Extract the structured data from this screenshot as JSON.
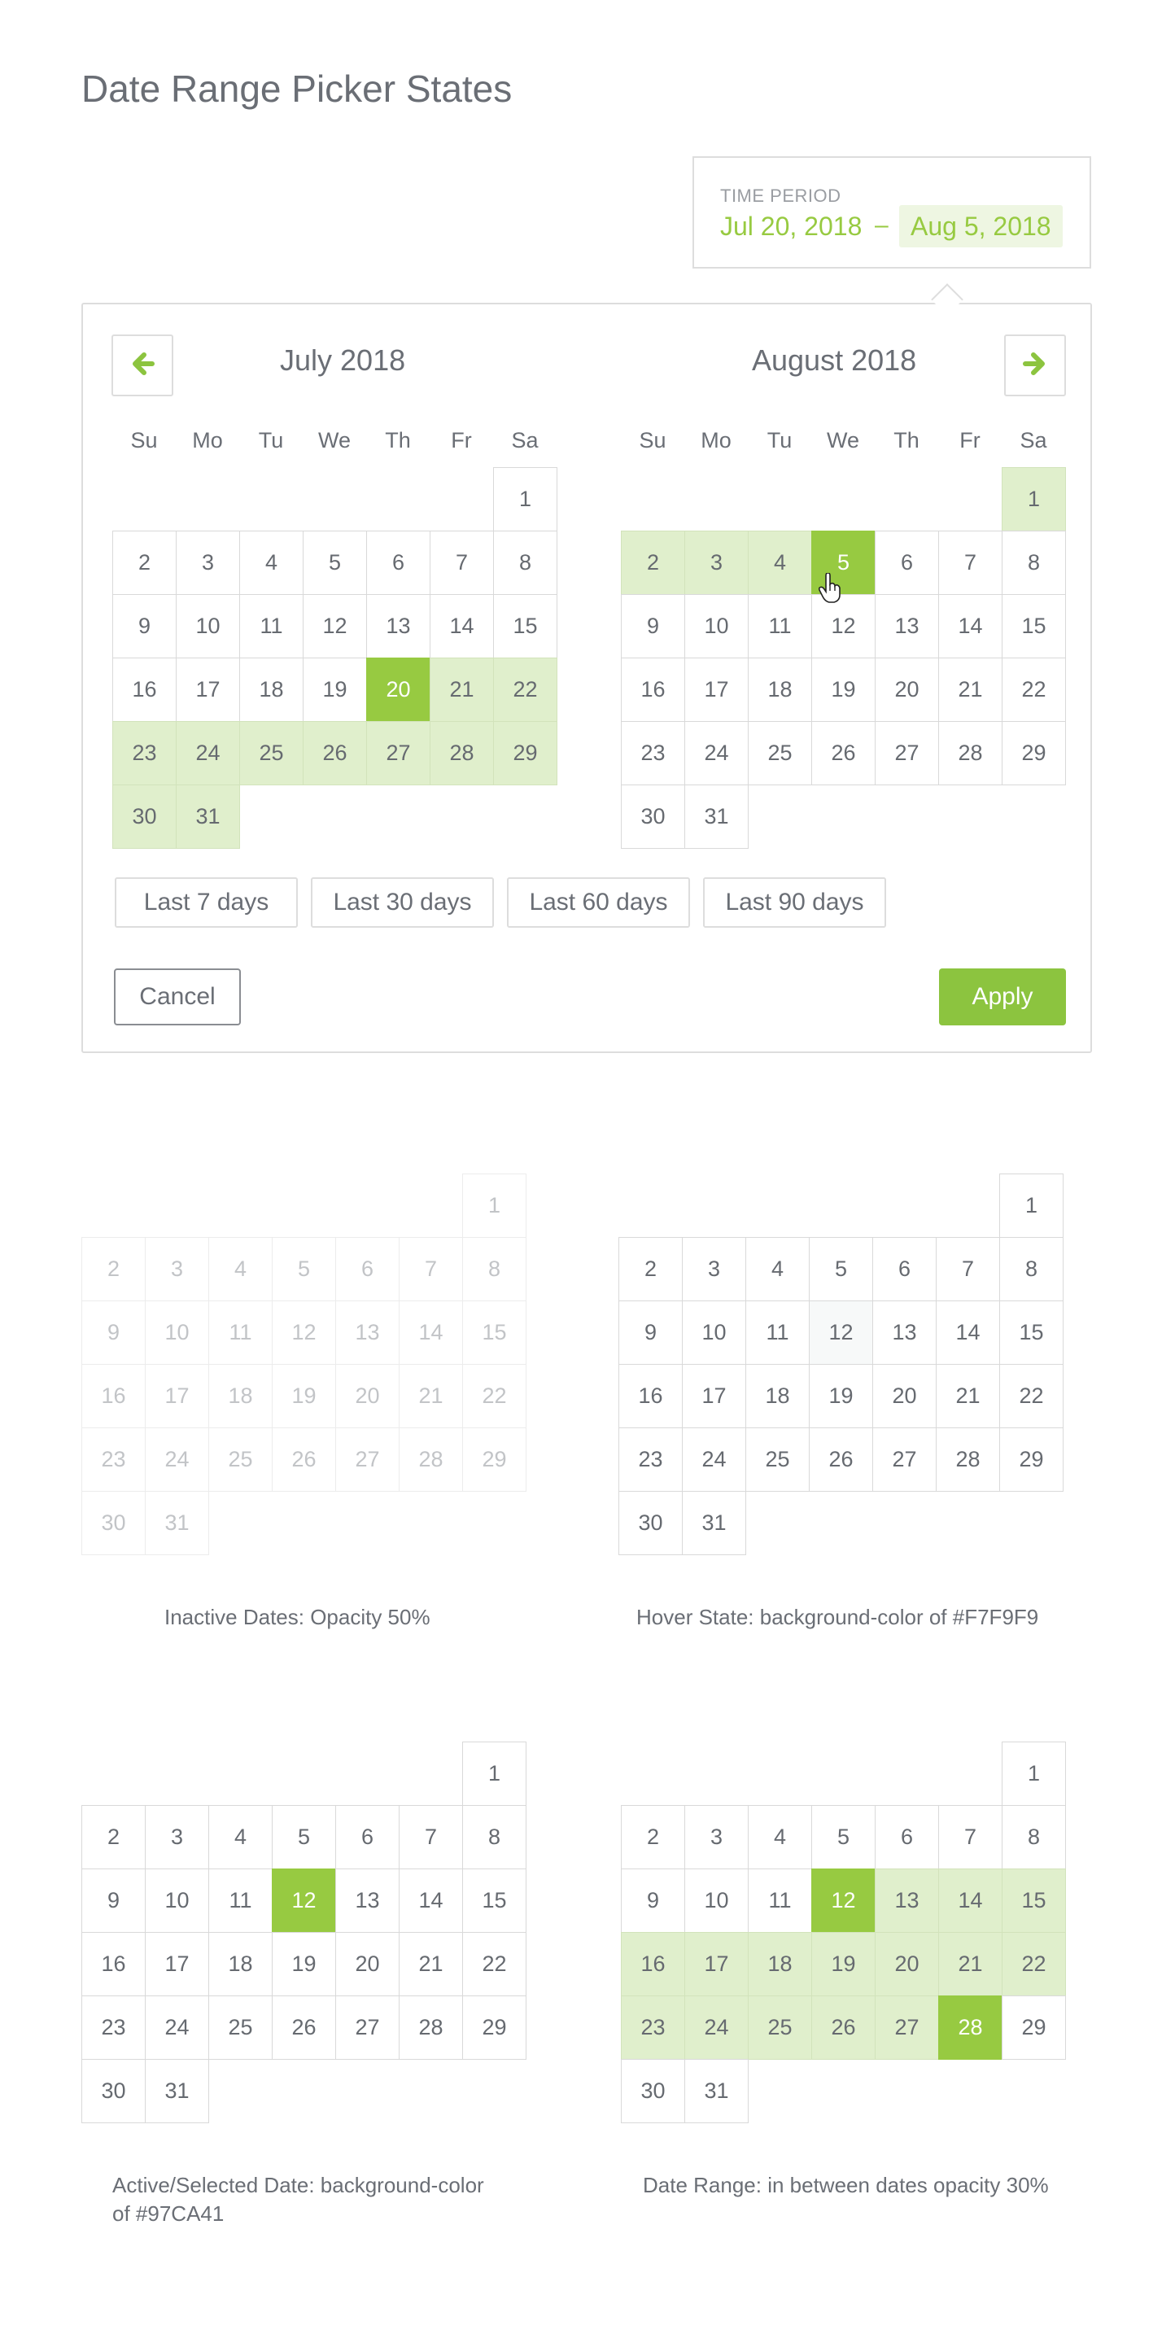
{
  "page_title": "Date Range Picker States",
  "time_period": {
    "label": "TIME PERIOD",
    "start": "Jul 20, 2018",
    "separator": "–",
    "end": "Aug 5, 2018"
  },
  "picker": {
    "prev_icon": "arrow-left-icon",
    "next_icon": "arrow-right-icon",
    "left_month": "July 2018",
    "right_month": "August 2018",
    "weekdays": [
      "Su",
      "Mo",
      "Tu",
      "We",
      "Th",
      "Fr",
      "Sa"
    ],
    "quick_ranges": [
      "Last 7 days",
      "Last 30 days",
      "Last 60 days",
      "Last 90 days"
    ],
    "cancel_label": "Cancel",
    "apply_label": "Apply"
  },
  "states": {
    "inactive_caption": "Inactive Dates: Opacity 50%",
    "hover_caption": "Hover State: background-color of #F7F9F9",
    "active_caption": "Active/Selected Date: background-color of #97CA41",
    "range_caption": "Date Range: in between dates opacity 30%"
  },
  "colors": {
    "accent": "#97CA41",
    "in_range": "#e0efcc",
    "hover": "#F7F9F9"
  }
}
